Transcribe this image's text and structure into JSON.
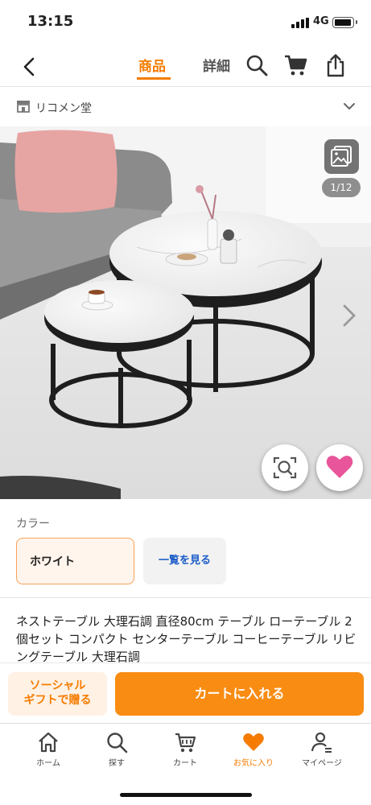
{
  "status": {
    "time": "13:15",
    "network": "4G"
  },
  "nav": {
    "tabs": [
      {
        "label": "商品",
        "active": true
      },
      {
        "label": "詳細",
        "active": false
      }
    ],
    "icons": [
      "back-icon",
      "search-icon",
      "cart-icon",
      "share-icon"
    ]
  },
  "store": {
    "name": "リコメン堂"
  },
  "gallery": {
    "counter": "1/12"
  },
  "color": {
    "label": "カラー",
    "selected": "ホワイト",
    "list_button": "一覧を見る"
  },
  "product": {
    "title": "ネストテーブル 大理石調 直径80cm テーブル ローテーブル 2個セット コンパクト センターテーブル コーヒーテーブル リビングテーブル 大理石調"
  },
  "actions": {
    "gift_line1": "ソーシャル",
    "gift_line2": "ギフトで贈る",
    "add_to_cart": "カートに入れる"
  },
  "tabbar": [
    {
      "label": "ホーム",
      "icon": "home-icon",
      "active": false
    },
    {
      "label": "探す",
      "icon": "search-icon",
      "active": false
    },
    {
      "label": "カート",
      "icon": "cart-icon",
      "active": false
    },
    {
      "label": "お気に入り",
      "icon": "heart-icon",
      "active": true
    },
    {
      "label": "マイページ",
      "icon": "user-icon",
      "active": false
    }
  ],
  "colors": {
    "accent": "#f57c00",
    "cart_button": "#f98c13",
    "link": "#1a5cc8",
    "favorite": "#e8559a"
  }
}
